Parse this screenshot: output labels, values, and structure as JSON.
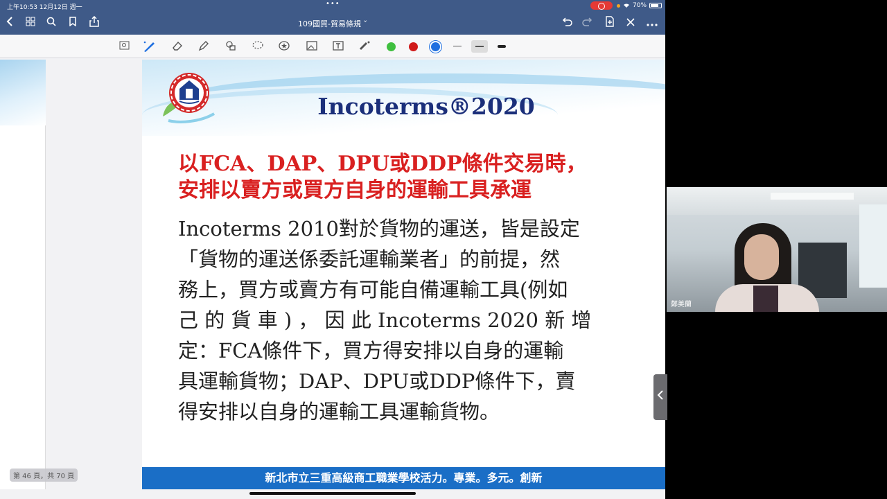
{
  "statusbar": {
    "time": "上午10:53  12月12日 週一",
    "dots": "•••",
    "battery": "70%"
  },
  "navbar": {
    "title": "109國貿-貿易條規 ˅",
    "icons": [
      "back-icon",
      "grid-icon",
      "search-icon",
      "bookmark-icon",
      "share-icon",
      "undo-icon",
      "redo-icon",
      "add-page-icon",
      "close-icon",
      "more-icon"
    ]
  },
  "toolbar": {
    "tools": [
      "zoom-select-icon",
      "pen-icon",
      "eraser-icon",
      "highlighter-icon",
      "shapes-icon",
      "lasso-icon",
      "sticker-icon",
      "image-icon",
      "text-icon",
      "laser-pointer-icon"
    ],
    "colors": [
      "#3fbf3f",
      "#d01a1a",
      "#1e6fe0"
    ]
  },
  "document": {
    "page_indicator": "第 46 頁，共 70 頁"
  },
  "slide": {
    "title": "Incoterms®2020",
    "heading": [
      "以FCA、DAP、DPU或DDP條件交易時，",
      "安排以賣方或買方自身的運輸工具承運"
    ],
    "body": [
      "Incoterms 2010對於貨物的運送，皆是設定",
      "「貨物的運送係委託運輸業者」的前提，然",
      "務上，買方或賣方有可能自備運輸工具(例如",
      "己 的 貨 車 ) ， 因 此 Incoterms  2020 新 增",
      "定：FCA條件下，買方得安排以自身的運輸",
      "具運輸貨物；DAP、DPU或DDP條件下，賣",
      "得安排以自身的運輸工具運輸貨物。"
    ],
    "footer": "新北市立三重高級商工職業學校活力。專業。多元。創新"
  },
  "video": {
    "participant_name": "鄭美蘭"
  }
}
